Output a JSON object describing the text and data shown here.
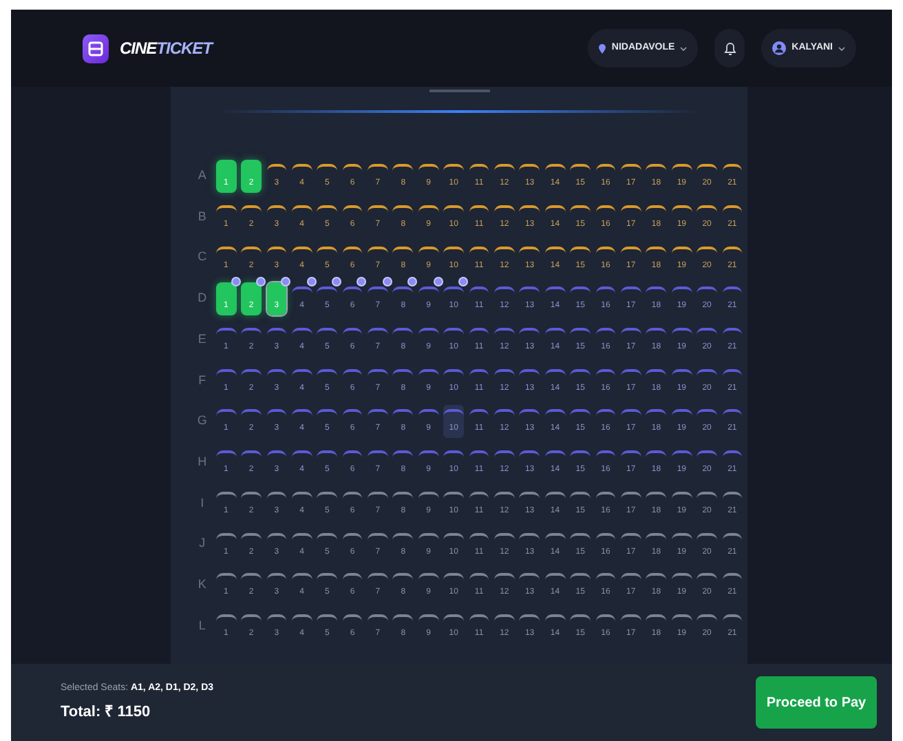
{
  "header": {
    "brand": {
      "first": "CINE",
      "second": "TICKET"
    },
    "location": "NIDADAVOLE",
    "user": "KALYANI"
  },
  "seat_map": {
    "rows": [
      {
        "label": "A",
        "kind": "gold",
        "seats": [
          {
            "number": "1",
            "selected": true
          },
          {
            "number": "2",
            "selected": true
          },
          {
            "number": "3",
            "selected": false
          },
          {
            "number": "4",
            "selected": false
          },
          {
            "number": "5",
            "selected": false
          },
          {
            "number": "6",
            "selected": false
          },
          {
            "number": "7",
            "selected": false
          },
          {
            "number": "8",
            "selected": false
          },
          {
            "number": "9",
            "selected": false
          },
          {
            "number": "10",
            "selected": false
          },
          {
            "number": "11",
            "selected": false
          },
          {
            "number": "12",
            "selected": false
          },
          {
            "number": "13",
            "selected": false
          },
          {
            "number": "14",
            "selected": false
          },
          {
            "number": "15",
            "selected": false
          },
          {
            "number": "16",
            "selected": false
          },
          {
            "number": "17",
            "selected": false
          },
          {
            "number": "18",
            "selected": false
          },
          {
            "number": "19",
            "selected": false
          },
          {
            "number": "20",
            "selected": false
          },
          {
            "number": "21",
            "selected": false
          }
        ]
      },
      {
        "label": "B",
        "kind": "gold",
        "seats": [
          {
            "number": "1",
            "selected": false
          },
          {
            "number": "2",
            "selected": false
          },
          {
            "number": "3",
            "selected": false
          },
          {
            "number": "4",
            "selected": false
          },
          {
            "number": "5",
            "selected": false
          },
          {
            "number": "6",
            "selected": false
          },
          {
            "number": "7",
            "selected": false
          },
          {
            "number": "8",
            "selected": false
          },
          {
            "number": "9",
            "selected": false
          },
          {
            "number": "10",
            "selected": false
          },
          {
            "number": "11",
            "selected": false
          },
          {
            "number": "12",
            "selected": false
          },
          {
            "number": "13",
            "selected": false
          },
          {
            "number": "14",
            "selected": false
          },
          {
            "number": "15",
            "selected": false
          },
          {
            "number": "16",
            "selected": false
          },
          {
            "number": "17",
            "selected": false
          },
          {
            "number": "18",
            "selected": false
          },
          {
            "number": "19",
            "selected": false
          },
          {
            "number": "20",
            "selected": false
          },
          {
            "number": "21",
            "selected": false
          }
        ]
      },
      {
        "label": "C",
        "kind": "gold",
        "seats": [
          {
            "number": "1",
            "selected": false
          },
          {
            "number": "2",
            "selected": false
          },
          {
            "number": "3",
            "selected": false
          },
          {
            "number": "4",
            "selected": false
          },
          {
            "number": "5",
            "selected": false
          },
          {
            "number": "6",
            "selected": false
          },
          {
            "number": "7",
            "selected": false
          },
          {
            "number": "8",
            "selected": false
          },
          {
            "number": "9",
            "selected": false
          },
          {
            "number": "10",
            "selected": false
          },
          {
            "number": "11",
            "selected": false
          },
          {
            "number": "12",
            "selected": false
          },
          {
            "number": "13",
            "selected": false
          },
          {
            "number": "14",
            "selected": false
          },
          {
            "number": "15",
            "selected": false
          },
          {
            "number": "16",
            "selected": false
          },
          {
            "number": "17",
            "selected": false
          },
          {
            "number": "18",
            "selected": false
          },
          {
            "number": "19",
            "selected": false
          },
          {
            "number": "20",
            "selected": false
          },
          {
            "number": "21",
            "selected": false
          }
        ]
      },
      {
        "label": "D",
        "kind": "blue",
        "seats": [
          {
            "number": "1",
            "selected": true,
            "dot": true
          },
          {
            "number": "2",
            "selected": true,
            "dot": true
          },
          {
            "number": "3",
            "selected": true,
            "focused": true,
            "dot": true
          },
          {
            "number": "4",
            "selected": false,
            "dot": true
          },
          {
            "number": "5",
            "selected": false,
            "dot": true
          },
          {
            "number": "6",
            "selected": false,
            "dot": true
          },
          {
            "number": "7",
            "selected": false,
            "dot": true
          },
          {
            "number": "8",
            "selected": false,
            "dot": true
          },
          {
            "number": "9",
            "selected": false,
            "dot": true
          },
          {
            "number": "10",
            "selected": false,
            "dot": true
          },
          {
            "number": "11",
            "selected": false,
            "dot": false
          },
          {
            "number": "12",
            "selected": false,
            "dot": false
          },
          {
            "number": "13",
            "selected": false,
            "dot": false
          },
          {
            "number": "14",
            "selected": false,
            "dot": false
          },
          {
            "number": "15",
            "selected": false,
            "dot": false
          },
          {
            "number": "16",
            "selected": false,
            "dot": false
          },
          {
            "number": "17",
            "selected": false,
            "dot": false
          },
          {
            "number": "18",
            "selected": false,
            "dot": false
          },
          {
            "number": "19",
            "selected": false,
            "dot": false
          },
          {
            "number": "20",
            "selected": false,
            "dot": false
          },
          {
            "number": "21",
            "selected": false,
            "dot": false
          }
        ]
      },
      {
        "label": "E",
        "kind": "blue",
        "seats": [
          {
            "number": "1",
            "selected": false
          },
          {
            "number": "2",
            "selected": false
          },
          {
            "number": "3",
            "selected": false
          },
          {
            "number": "4",
            "selected": false
          },
          {
            "number": "5",
            "selected": false
          },
          {
            "number": "6",
            "selected": false
          },
          {
            "number": "7",
            "selected": false
          },
          {
            "number": "8",
            "selected": false
          },
          {
            "number": "9",
            "selected": false
          },
          {
            "number": "10",
            "selected": false
          },
          {
            "number": "11",
            "selected": false
          },
          {
            "number": "12",
            "selected": false
          },
          {
            "number": "13",
            "selected": false
          },
          {
            "number": "14",
            "selected": false
          },
          {
            "number": "15",
            "selected": false
          },
          {
            "number": "16",
            "selected": false
          },
          {
            "number": "17",
            "selected": false
          },
          {
            "number": "18",
            "selected": false
          },
          {
            "number": "19",
            "selected": false
          },
          {
            "number": "20",
            "selected": false
          },
          {
            "number": "21",
            "selected": false
          }
        ]
      },
      {
        "label": "F",
        "kind": "blue",
        "seats": [
          {
            "number": "1",
            "selected": false
          },
          {
            "number": "2",
            "selected": false
          },
          {
            "number": "3",
            "selected": false
          },
          {
            "number": "4",
            "selected": false
          },
          {
            "number": "5",
            "selected": false
          },
          {
            "number": "6",
            "selected": false
          },
          {
            "number": "7",
            "selected": false
          },
          {
            "number": "8",
            "selected": false
          },
          {
            "number": "9",
            "selected": false
          },
          {
            "number": "10",
            "selected": false
          },
          {
            "number": "11",
            "selected": false
          },
          {
            "number": "12",
            "selected": false
          },
          {
            "number": "13",
            "selected": false
          },
          {
            "number": "14",
            "selected": false
          },
          {
            "number": "15",
            "selected": false
          },
          {
            "number": "16",
            "selected": false
          },
          {
            "number": "17",
            "selected": false
          },
          {
            "number": "18",
            "selected": false
          },
          {
            "number": "19",
            "selected": false
          },
          {
            "number": "20",
            "selected": false
          },
          {
            "number": "21",
            "selected": false
          }
        ]
      },
      {
        "label": "G",
        "kind": "blue",
        "seats": [
          {
            "number": "1",
            "selected": false
          },
          {
            "number": "2",
            "selected": false
          },
          {
            "number": "3",
            "selected": false
          },
          {
            "number": "4",
            "selected": false
          },
          {
            "number": "5",
            "selected": false
          },
          {
            "number": "6",
            "selected": false
          },
          {
            "number": "7",
            "selected": false
          },
          {
            "number": "8",
            "selected": false
          },
          {
            "number": "9",
            "selected": false
          },
          {
            "number": "10",
            "selected": false,
            "hovered": true
          },
          {
            "number": "11",
            "selected": false
          },
          {
            "number": "12",
            "selected": false
          },
          {
            "number": "13",
            "selected": false
          },
          {
            "number": "14",
            "selected": false
          },
          {
            "number": "15",
            "selected": false
          },
          {
            "number": "16",
            "selected": false
          },
          {
            "number": "17",
            "selected": false
          },
          {
            "number": "18",
            "selected": false
          },
          {
            "number": "19",
            "selected": false
          },
          {
            "number": "20",
            "selected": false
          },
          {
            "number": "21",
            "selected": false
          }
        ]
      },
      {
        "label": "H",
        "kind": "blue",
        "seats": [
          {
            "number": "1",
            "selected": false
          },
          {
            "number": "2",
            "selected": false
          },
          {
            "number": "3",
            "selected": false
          },
          {
            "number": "4",
            "selected": false
          },
          {
            "number": "5",
            "selected": false
          },
          {
            "number": "6",
            "selected": false
          },
          {
            "number": "7",
            "selected": false
          },
          {
            "number": "8",
            "selected": false
          },
          {
            "number": "9",
            "selected": false
          },
          {
            "number": "10",
            "selected": false
          },
          {
            "number": "11",
            "selected": false
          },
          {
            "number": "12",
            "selected": false
          },
          {
            "number": "13",
            "selected": false
          },
          {
            "number": "14",
            "selected": false
          },
          {
            "number": "15",
            "selected": false
          },
          {
            "number": "16",
            "selected": false
          },
          {
            "number": "17",
            "selected": false
          },
          {
            "number": "18",
            "selected": false
          },
          {
            "number": "19",
            "selected": false
          },
          {
            "number": "20",
            "selected": false
          },
          {
            "number": "21",
            "selected": false
          }
        ]
      },
      {
        "label": "I",
        "kind": "grey",
        "seats": [
          {
            "number": "1",
            "selected": false
          },
          {
            "number": "2",
            "selected": false
          },
          {
            "number": "3",
            "selected": false
          },
          {
            "number": "4",
            "selected": false
          },
          {
            "number": "5",
            "selected": false
          },
          {
            "number": "6",
            "selected": false
          },
          {
            "number": "7",
            "selected": false
          },
          {
            "number": "8",
            "selected": false
          },
          {
            "number": "9",
            "selected": false
          },
          {
            "number": "10",
            "selected": false
          },
          {
            "number": "11",
            "selected": false
          },
          {
            "number": "12",
            "selected": false
          },
          {
            "number": "13",
            "selected": false
          },
          {
            "number": "14",
            "selected": false
          },
          {
            "number": "15",
            "selected": false
          },
          {
            "number": "16",
            "selected": false
          },
          {
            "number": "17",
            "selected": false
          },
          {
            "number": "18",
            "selected": false
          },
          {
            "number": "19",
            "selected": false
          },
          {
            "number": "20",
            "selected": false
          },
          {
            "number": "21",
            "selected": false
          }
        ]
      },
      {
        "label": "J",
        "kind": "grey",
        "seats": [
          {
            "number": "1",
            "selected": false
          },
          {
            "number": "2",
            "selected": false
          },
          {
            "number": "3",
            "selected": false
          },
          {
            "number": "4",
            "selected": false
          },
          {
            "number": "5",
            "selected": false
          },
          {
            "number": "6",
            "selected": false
          },
          {
            "number": "7",
            "selected": false
          },
          {
            "number": "8",
            "selected": false
          },
          {
            "number": "9",
            "selected": false
          },
          {
            "number": "10",
            "selected": false
          },
          {
            "number": "11",
            "selected": false
          },
          {
            "number": "12",
            "selected": false
          },
          {
            "number": "13",
            "selected": false
          },
          {
            "number": "14",
            "selected": false
          },
          {
            "number": "15",
            "selected": false
          },
          {
            "number": "16",
            "selected": false
          },
          {
            "number": "17",
            "selected": false
          },
          {
            "number": "18",
            "selected": false
          },
          {
            "number": "19",
            "selected": false
          },
          {
            "number": "20",
            "selected": false
          },
          {
            "number": "21",
            "selected": false
          }
        ]
      },
      {
        "label": "K",
        "kind": "grey",
        "seats": [
          {
            "number": "1",
            "selected": false
          },
          {
            "number": "2",
            "selected": false
          },
          {
            "number": "3",
            "selected": false
          },
          {
            "number": "4",
            "selected": false
          },
          {
            "number": "5",
            "selected": false
          },
          {
            "number": "6",
            "selected": false
          },
          {
            "number": "7",
            "selected": false
          },
          {
            "number": "8",
            "selected": false
          },
          {
            "number": "9",
            "selected": false
          },
          {
            "number": "10",
            "selected": false
          },
          {
            "number": "11",
            "selected": false
          },
          {
            "number": "12",
            "selected": false
          },
          {
            "number": "13",
            "selected": false
          },
          {
            "number": "14",
            "selected": false
          },
          {
            "number": "15",
            "selected": false
          },
          {
            "number": "16",
            "selected": false
          },
          {
            "number": "17",
            "selected": false
          },
          {
            "number": "18",
            "selected": false
          },
          {
            "number": "19",
            "selected": false
          },
          {
            "number": "20",
            "selected": false
          },
          {
            "number": "21",
            "selected": false
          }
        ]
      },
      {
        "label": "L",
        "kind": "grey",
        "seats": [
          {
            "number": "1",
            "selected": false
          },
          {
            "number": "2",
            "selected": false
          },
          {
            "number": "3",
            "selected": false
          },
          {
            "number": "4",
            "selected": false
          },
          {
            "number": "5",
            "selected": false
          },
          {
            "number": "6",
            "selected": false
          },
          {
            "number": "7",
            "selected": false
          },
          {
            "number": "8",
            "selected": false
          },
          {
            "number": "9",
            "selected": false
          },
          {
            "number": "10",
            "selected": false
          },
          {
            "number": "11",
            "selected": false
          },
          {
            "number": "12",
            "selected": false
          },
          {
            "number": "13",
            "selected": false
          },
          {
            "number": "14",
            "selected": false
          },
          {
            "number": "15",
            "selected": false
          },
          {
            "number": "16",
            "selected": false
          },
          {
            "number": "17",
            "selected": false
          },
          {
            "number": "18",
            "selected": false
          },
          {
            "number": "19",
            "selected": false
          },
          {
            "number": "20",
            "selected": false
          },
          {
            "number": "21",
            "selected": false
          }
        ]
      }
    ]
  },
  "footer": {
    "selected_seats": "Selected Seats: **A1, A2, D1, D2, D3**",
    "total": "Total: ₹ 1150",
    "button": "Proceed to Pay"
  }
}
